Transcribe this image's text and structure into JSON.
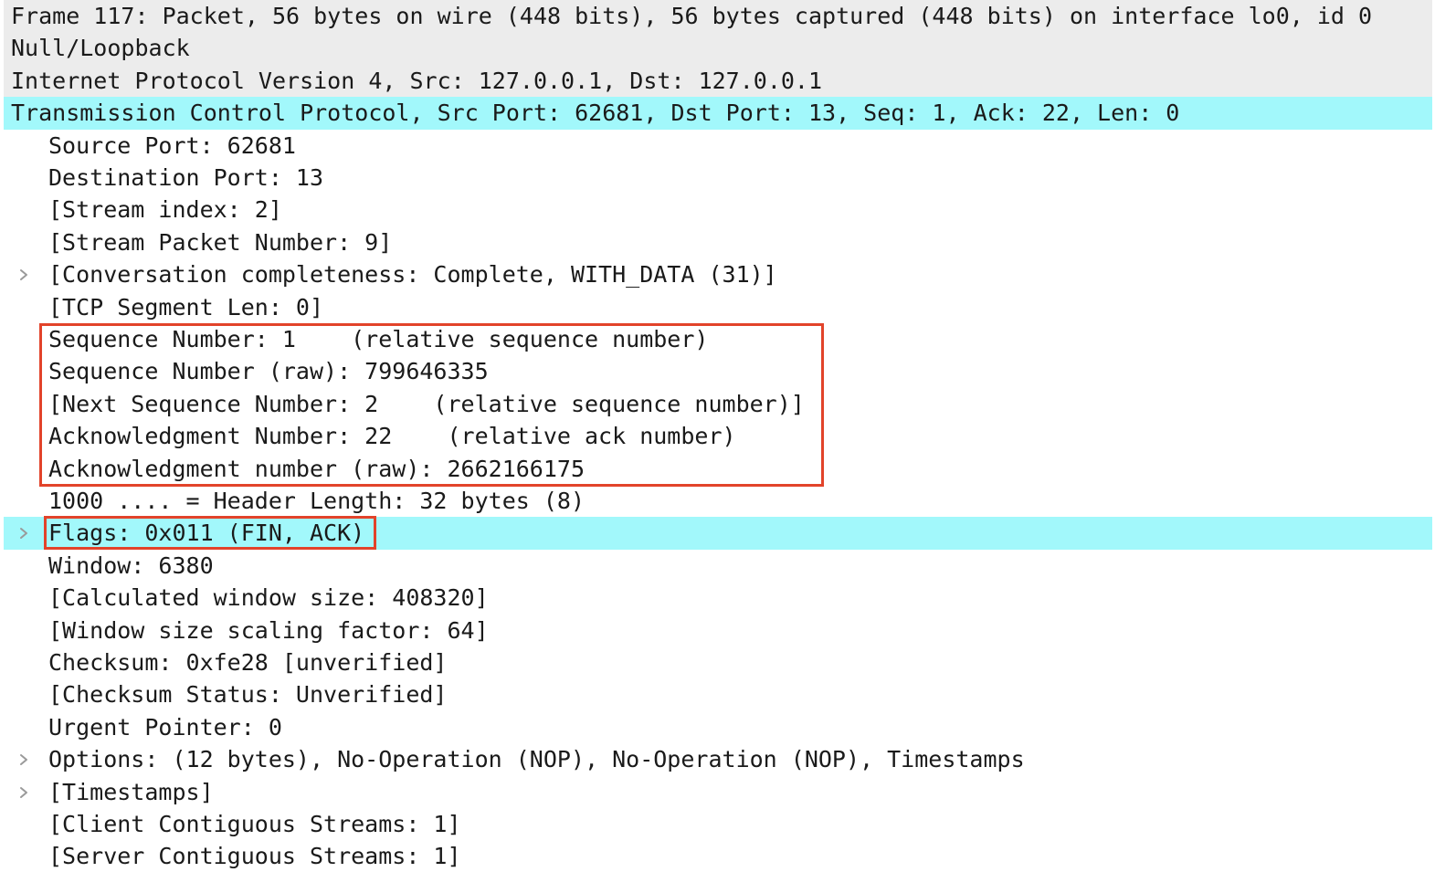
{
  "colors": {
    "selected_row": "#a2f8fb",
    "header_row": "#ececec",
    "annotation_box": "#e2432a",
    "expander": "#9a9a9a"
  },
  "rows": [
    {
      "text": "Frame 117: Packet, 56 bytes on wire (448 bits), 56 bytes captured (448 bits) on interface lo0, id 0",
      "level": 0,
      "expander": false,
      "style": "gray"
    },
    {
      "text": "Null/Loopback",
      "level": 0,
      "expander": false,
      "style": "gray"
    },
    {
      "text": "Internet Protocol Version 4, Src: 127.0.0.1, Dst: 127.0.0.1",
      "level": 0,
      "expander": false,
      "style": "gray"
    },
    {
      "text": "Transmission Control Protocol, Src Port: 62681, Dst Port: 13, Seq: 1, Ack: 22, Len: 0",
      "level": 0,
      "expander": false,
      "style": "cyan"
    },
    {
      "text": "Source Port: 62681",
      "level": 1,
      "expander": false,
      "style": ""
    },
    {
      "text": "Destination Port: 13",
      "level": 1,
      "expander": false,
      "style": ""
    },
    {
      "text": "[Stream index: 2]",
      "level": 1,
      "expander": false,
      "style": ""
    },
    {
      "text": "[Stream Packet Number: 9]",
      "level": 1,
      "expander": false,
      "style": ""
    },
    {
      "text": "[Conversation completeness: Complete, WITH_DATA (31)]",
      "level": 1,
      "expander": true,
      "style": ""
    },
    {
      "text": "[TCP Segment Len: 0]",
      "level": 1,
      "expander": false,
      "style": ""
    },
    {
      "text": "Sequence Number: 1    (relative sequence number)",
      "level": 1,
      "expander": false,
      "style": ""
    },
    {
      "text": "Sequence Number (raw): 799646335",
      "level": 1,
      "expander": false,
      "style": ""
    },
    {
      "text": "[Next Sequence Number: 2    (relative sequence number)]",
      "level": 1,
      "expander": false,
      "style": ""
    },
    {
      "text": "Acknowledgment Number: 22    (relative ack number)",
      "level": 1,
      "expander": false,
      "style": ""
    },
    {
      "text": "Acknowledgment number (raw): 2662166175",
      "level": 1,
      "expander": false,
      "style": ""
    },
    {
      "text": "1000 .... = Header Length: 32 bytes (8)",
      "level": 1,
      "expander": false,
      "style": ""
    },
    {
      "text": "Flags: 0x011 (FIN, ACK)",
      "level": 1,
      "expander": true,
      "style": "cyan"
    },
    {
      "text": "Window: 6380",
      "level": 1,
      "expander": false,
      "style": ""
    },
    {
      "text": "[Calculated window size: 408320]",
      "level": 1,
      "expander": false,
      "style": ""
    },
    {
      "text": "[Window size scaling factor: 64]",
      "level": 1,
      "expander": false,
      "style": ""
    },
    {
      "text": "Checksum: 0xfe28 [unverified]",
      "level": 1,
      "expander": false,
      "style": ""
    },
    {
      "text": "[Checksum Status: Unverified]",
      "level": 1,
      "expander": false,
      "style": ""
    },
    {
      "text": "Urgent Pointer: 0",
      "level": 1,
      "expander": false,
      "style": ""
    },
    {
      "text": "Options: (12 bytes), No-Operation (NOP), No-Operation (NOP), Timestamps",
      "level": 1,
      "expander": true,
      "style": ""
    },
    {
      "text": "[Timestamps]",
      "level": 1,
      "expander": true,
      "style": ""
    },
    {
      "text": "[Client Contiguous Streams: 1]",
      "level": 1,
      "expander": false,
      "style": ""
    },
    {
      "text": "[Server Contiguous Streams: 1]",
      "level": 1,
      "expander": false,
      "style": ""
    }
  ]
}
